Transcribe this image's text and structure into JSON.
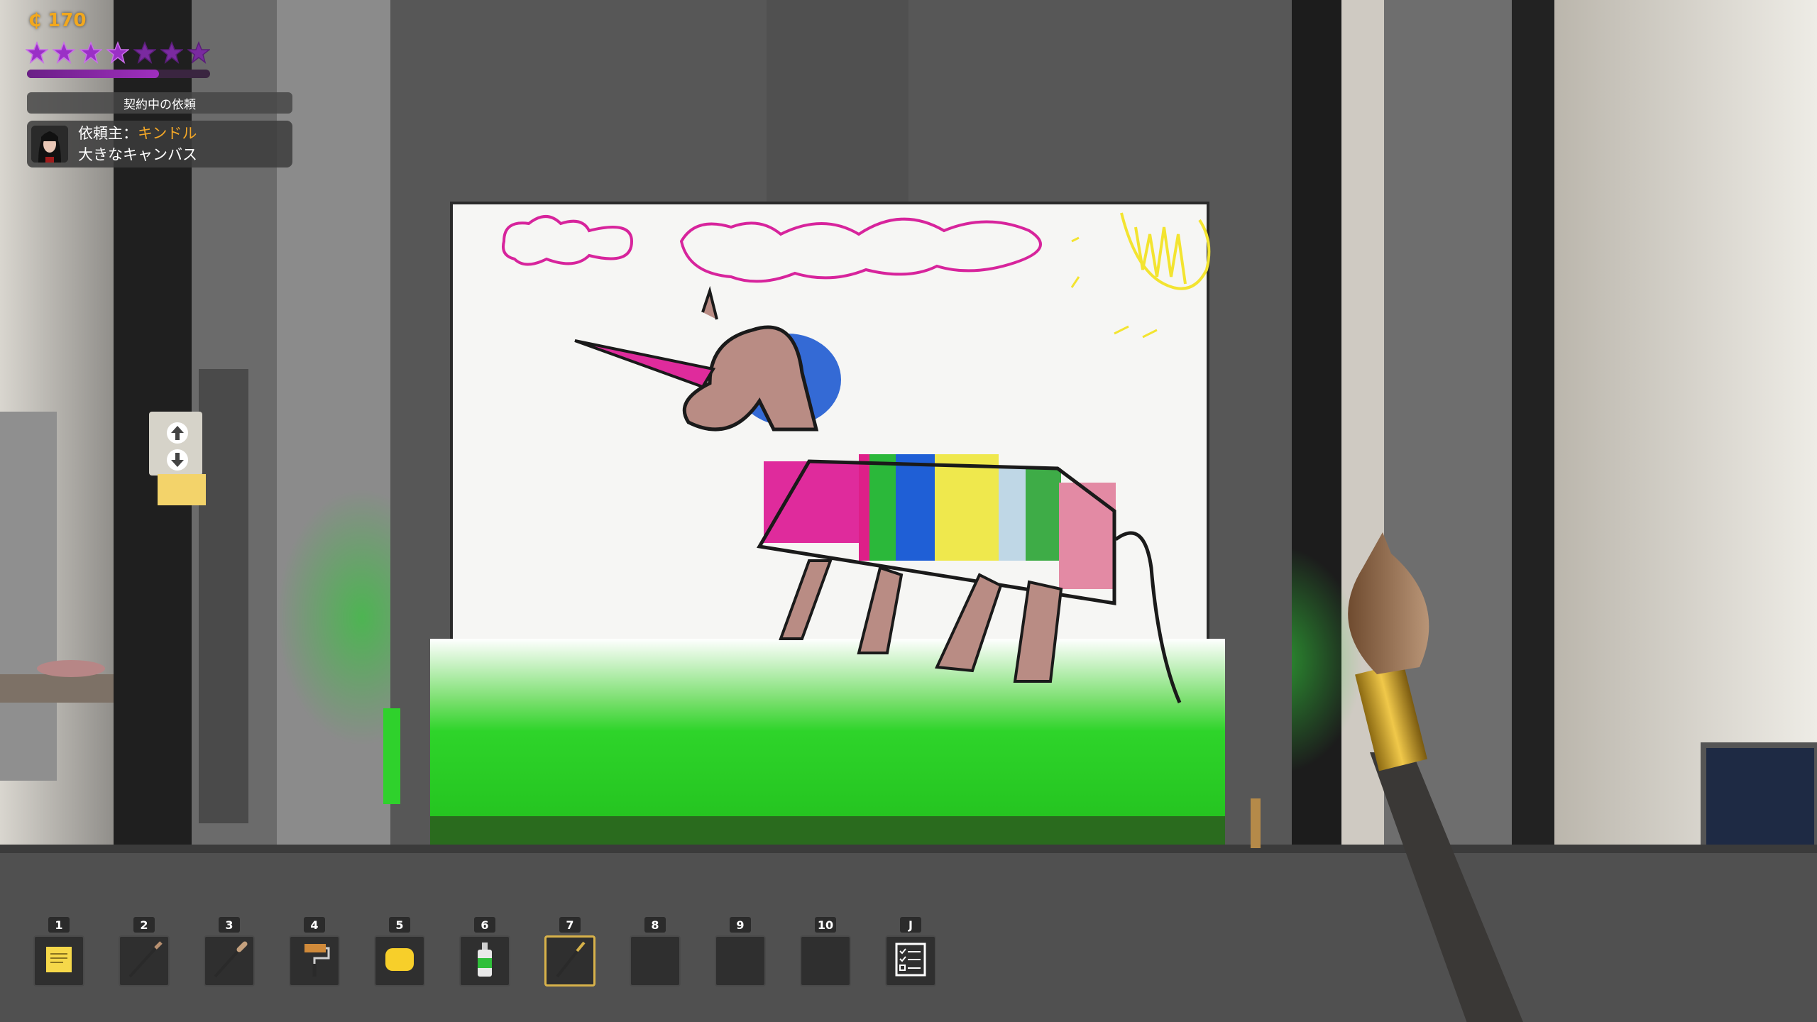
{
  "hud": {
    "currency": "₵ 170",
    "stars": {
      "total": 7,
      "filled": 4
    },
    "reputation_progress": 0.72,
    "contract_header": "契約中の依頼",
    "client_label": "依頼主：",
    "client_name": "キンドル",
    "request_title": "大きなキャンバス"
  },
  "hotbar": [
    {
      "key": "1",
      "item": "sticky-note-icon"
    },
    {
      "key": "2",
      "item": "fine-brush-icon"
    },
    {
      "key": "3",
      "item": "round-brush-icon"
    },
    {
      "key": "4",
      "item": "paint-roller-icon"
    },
    {
      "key": "5",
      "item": "sponge-icon"
    },
    {
      "key": "6",
      "item": "spray-can-icon"
    },
    {
      "key": "7",
      "item": "wide-brush-icon",
      "selected": true
    },
    {
      "key": "8",
      "item": ""
    },
    {
      "key": "9",
      "item": ""
    },
    {
      "key": "10",
      "item": ""
    },
    {
      "key": "J",
      "item": "checklist-journal-icon"
    }
  ],
  "colors": {
    "currency": "#f2a81d",
    "client_name": "#f3a728",
    "star_filled": "#9a30c6",
    "star_empty": "#7a2aa0",
    "selected_slot": "#d8b24a"
  }
}
